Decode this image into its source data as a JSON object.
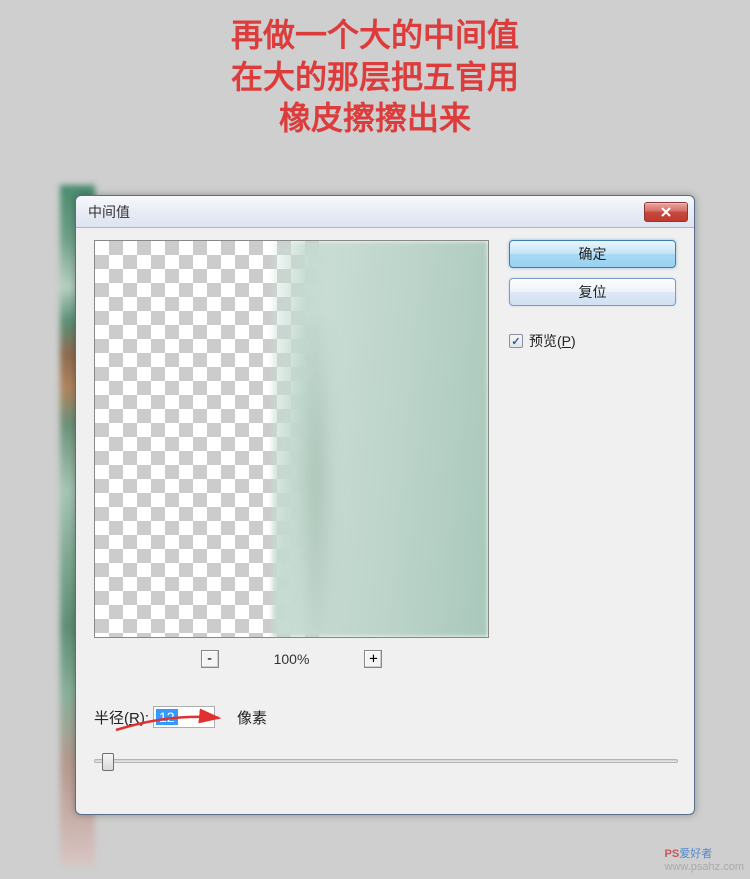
{
  "instruction": {
    "line1": "再做一个大的中间值",
    "line2": "在大的那层把五官用",
    "line3": "橡皮擦擦出来"
  },
  "dialog": {
    "title": "中间值",
    "ok_label": "确定",
    "reset_label": "复位",
    "preview_label": "预览(",
    "preview_key": "P",
    "preview_suffix": ")",
    "zoom_out": "-",
    "zoom_in": "+",
    "zoom_level": "100%",
    "radius_label": "半径(",
    "radius_key": "R",
    "radius_suffix": "):",
    "radius_value": "12",
    "unit_label": "像素",
    "checkmark": "✓"
  },
  "watermark": {
    "ps": "PS",
    "hz": "爱好者",
    "url": "www.psahz.com"
  }
}
